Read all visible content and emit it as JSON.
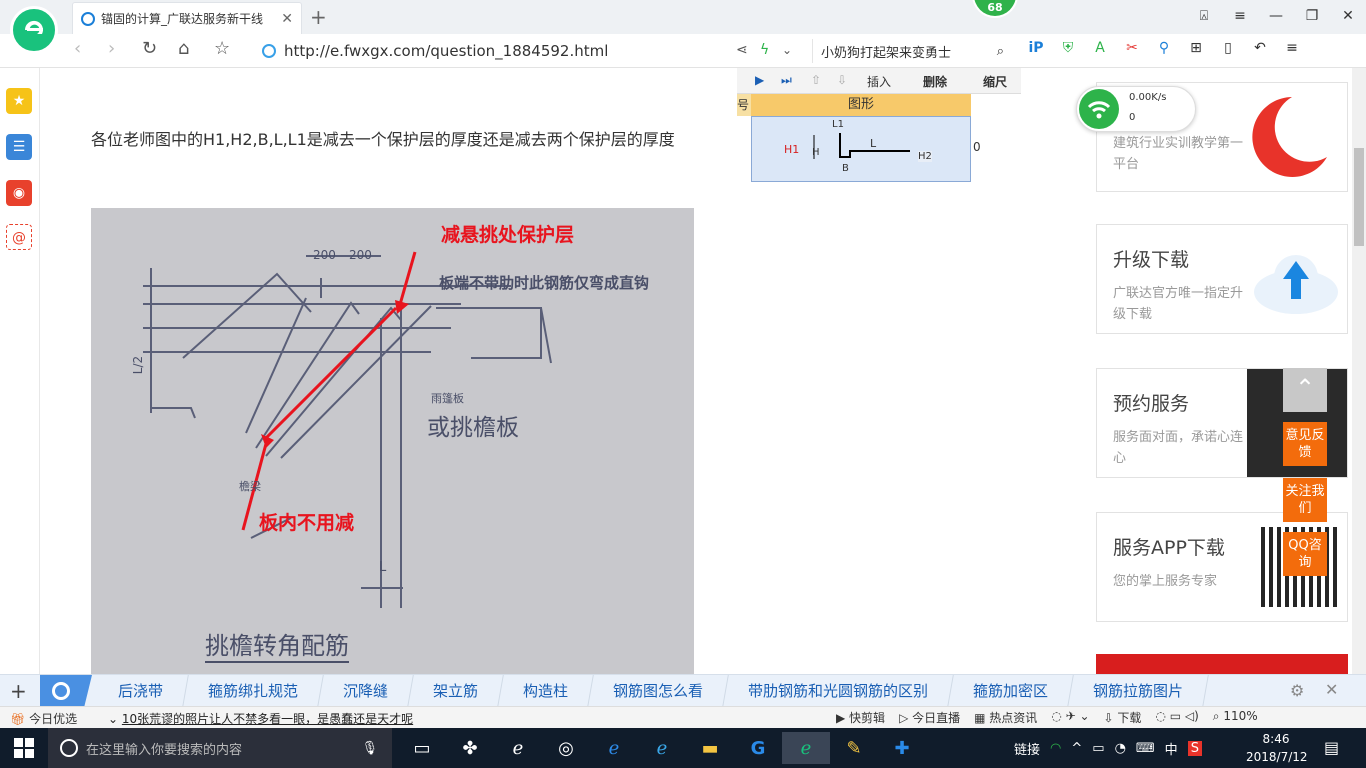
{
  "browser": {
    "tab_title": "锚固的计算_广联达服务新干线",
    "tab_close": "✕",
    "new_tab": "+",
    "badge": "68",
    "url": "http://e.fwxgx.com/question_1884592.html",
    "search_text": "小奶狗打起架来变勇士",
    "tools_badge": "2"
  },
  "question": {
    "text": "各位老师图中的H1,H2,B,L,L1是减去一个保护层的厚度还是减去两个保护层的厚度"
  },
  "photo": {
    "dim1": "200",
    "dim2": "200",
    "dim_l": "L",
    "dim_l2": "L/2",
    "annot_top": "减悬挑处保护层",
    "annot_bottom": "板内不用减",
    "note": "板端不带肋时此钢筋仅弯成直钩",
    "side": "或挑檐板",
    "side_small": "雨篷板",
    "bottom_small": "檐梁",
    "title": "挑檐转角配筋"
  },
  "snippet": {
    "btn_insert": "插入",
    "btn_delete": "删除",
    "btn_zoom": "缩尺",
    "col_left": "号",
    "header": "图形",
    "h1": "H1",
    "h": "H",
    "l1": "L1",
    "l": "L",
    "h2": "H2",
    "b": "B",
    "zero": "0"
  },
  "wifi": {
    "speed": "0.00K/s",
    "count": "0"
  },
  "sidebar": {
    "cards": [
      {
        "title": "",
        "sub": "建筑行业实训教学第一平台"
      },
      {
        "title": "升级下载",
        "sub": "广联达官方唯一指定升级下载"
      },
      {
        "title": "预约服务",
        "sub": "服务面对面，承诺心连心"
      },
      {
        "title": "服务APP下载",
        "sub": "您的掌上服务专家"
      }
    ]
  },
  "float": {
    "feedback": "意见反馈",
    "follow": "关注我们",
    "qq": "QQ咨询"
  },
  "keywords": [
    "后浇带",
    "箍筋绑扎规范",
    "沉降缝",
    "架立筋",
    "构造柱",
    "钢筋图怎么看",
    "带肋钢筋和光圆钢筋的区别",
    "箍筋加密区",
    "钢筋拉筋图片"
  ],
  "status": {
    "today": "今日优选",
    "news": "10张荒谬的照片让人不禁多看一眼，是愚蠢还是天才呢",
    "items": [
      "快剪辑",
      "今日直播",
      "热点资讯",
      "下载"
    ],
    "zoom": "110%"
  },
  "taskbar": {
    "search_placeholder": "在这里输入你要搜索的内容",
    "link": "链接",
    "lang": "中",
    "time": "8:46",
    "date": "2018/7/12"
  },
  "colors": {
    "accent": "#f36c0c",
    "link": "#1a5fb4",
    "green": "#2db34a"
  }
}
